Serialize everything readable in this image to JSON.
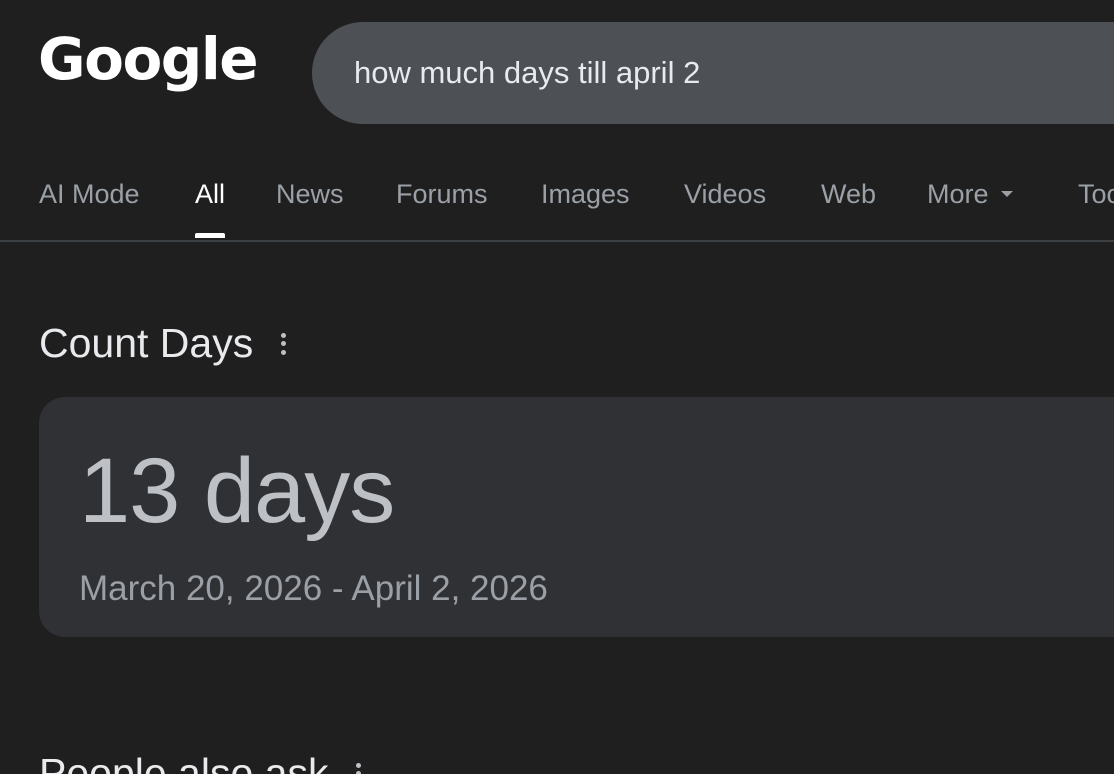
{
  "header": {
    "logo_text": "Google",
    "search_query": "how much days till april 2"
  },
  "tabs": [
    {
      "label": "AI Mode"
    },
    {
      "label": "All"
    },
    {
      "label": "News"
    },
    {
      "label": "Forums"
    },
    {
      "label": "Images"
    },
    {
      "label": "Videos"
    },
    {
      "label": "Web"
    },
    {
      "label": "More"
    },
    {
      "label": "Tools"
    }
  ],
  "active_tab": "All",
  "count_days": {
    "title": "Count Days",
    "result": "13 days",
    "range": "March 20, 2026 - April 2, 2026"
  },
  "people_also_ask": {
    "title": "People also ask"
  },
  "icons": {
    "more_options": "more-vert-icon",
    "dropdown": "chevron-down-icon"
  }
}
